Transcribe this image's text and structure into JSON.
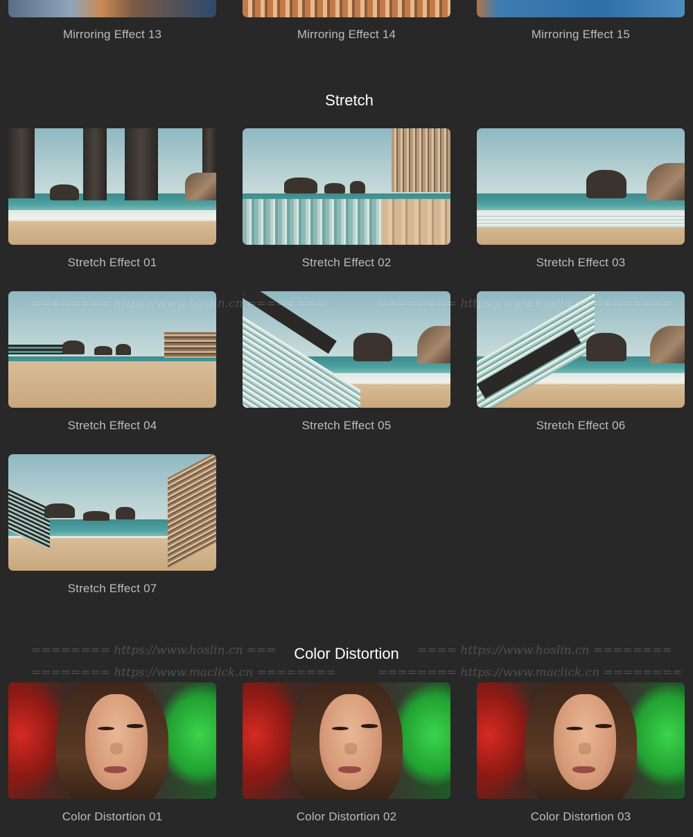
{
  "mirroring": {
    "items": [
      {
        "label": "Mirroring Effect 13"
      },
      {
        "label": "Mirroring Effect 14"
      },
      {
        "label": "Mirroring Effect 15"
      }
    ]
  },
  "stretch": {
    "title": "Stretch",
    "items": [
      {
        "label": "Stretch Effect 01"
      },
      {
        "label": "Stretch Effect 02"
      },
      {
        "label": "Stretch Effect 03"
      },
      {
        "label": "Stretch Effect 04"
      },
      {
        "label": "Stretch Effect 05"
      },
      {
        "label": "Stretch Effect 06"
      },
      {
        "label": "Stretch Effect 07"
      }
    ]
  },
  "color_distortion": {
    "title": "Color Distortion",
    "items": [
      {
        "label": "Color Distortion 01"
      },
      {
        "label": "Color Distortion 02"
      },
      {
        "label": "Color Distortion 03"
      }
    ]
  },
  "watermarks": [
    "======== https://www.hoslin.cn ========",
    "======== https://www.maclick.cn ========"
  ],
  "colors": {
    "background": "#282828",
    "caption": "#bdbdbd",
    "title": "#ffffff"
  }
}
